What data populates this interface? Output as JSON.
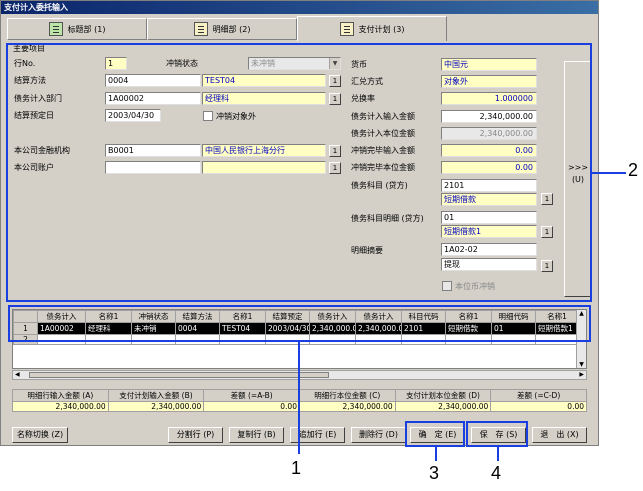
{
  "window": {
    "title": "支付计入委托输入"
  },
  "tabs": [
    {
      "label": "标题部 (1)"
    },
    {
      "label": "明细部 (2)"
    },
    {
      "label": "支付计划 (3)"
    }
  ],
  "form": {
    "group_title": "主要项目",
    "row_no": {
      "label": "行No.",
      "value": "1"
    },
    "cancel_status": {
      "label": "冲销状态",
      "value": "未冲销"
    },
    "settle_method": {
      "label": "结算方法",
      "code": "0004",
      "name": "TEST04"
    },
    "debt_dept": {
      "label": "债务计入部门",
      "code": "1A00002",
      "name": "经理科"
    },
    "settle_date": {
      "label": "结算预定日",
      "value": "2003/04/30"
    },
    "cancel_target": {
      "label": "冲销对象外"
    },
    "fin_org": {
      "label": "本公司金融机构",
      "code": "B0001",
      "name": "中国人民银行上海分行"
    },
    "company_account": {
      "label": "本公司账户",
      "code": "",
      "name": ""
    },
    "currency": {
      "label": "货币",
      "value": "中国元"
    },
    "exchange_method": {
      "label": "汇兑方式",
      "value": "对象外"
    },
    "exchange_rate": {
      "label": "兑换率",
      "value": "1.000000"
    },
    "debt_input_amount": {
      "label": "债务计入输入金额",
      "value": "2,340,000.00"
    },
    "debt_local_amount": {
      "label": "债务计入本位金额",
      "value": "2,340,000.00"
    },
    "cancel_input_amount": {
      "label": "冲销完毕输入金额",
      "value": "0.00"
    },
    "cancel_local_amount": {
      "label": "冲销完毕本位金额",
      "value": "0.00"
    },
    "debt_subject": {
      "label": "债务科目 (贷方)",
      "code": "2101",
      "name": "短期借款"
    },
    "debt_subject_detail": {
      "label": "债务科目明细 (贷方)",
      "code": "01",
      "name": "短期借款1"
    },
    "detail_summary": {
      "label": "明细摘要",
      "code": "1A02-02",
      "name": "提现"
    },
    "local_currency_cancel": {
      "label": "本位币冲销"
    },
    "side_arrow": ">>>",
    "side_key": "(U)"
  },
  "grid": {
    "headers": [
      "",
      "债务计入",
      "名称1",
      "冲销状态",
      "结算方法",
      "名称1",
      "结算预定",
      "债务计入",
      "债务计入",
      "科目代码",
      "名称1",
      "明细代码",
      "名称1"
    ],
    "rows": [
      [
        "1",
        "1A00002",
        "经理科",
        "未冲销",
        "0004",
        "TEST04",
        "2003/04/30",
        "2,340,000.00",
        "2,340,000.00",
        "2101",
        "短期借款",
        "01",
        "短期借款1"
      ],
      [
        "2",
        "",
        "",
        "",
        "",
        "",
        "",
        "",
        "",
        "",
        "",
        "",
        ""
      ]
    ]
  },
  "totals": {
    "headers": [
      "明细行输入金额 (A)",
      "支付计划输入金额 (B)",
      "差额 (=A-B)",
      "明细行本位金额 (C)",
      "支付计划本位金额 (D)",
      "差额 (=C-D)"
    ],
    "values": [
      "2,340,000.00",
      "2,340,000.00",
      "0.00",
      "2,340,000.00",
      "2,340,000.00",
      "0.00"
    ]
  },
  "buttons": {
    "name_switch": "名称切换 (Z)",
    "split_row": "分割行 (P)",
    "copy_row": "复制行 (B)",
    "add_row": "追加行 (E)",
    "delete_row": "删除行 (D)",
    "confirm": "确　定 (E)",
    "save": "保　存 (S)",
    "exit": "退　出 (X)"
  },
  "callouts": [
    "1",
    "2",
    "3",
    "4"
  ]
}
